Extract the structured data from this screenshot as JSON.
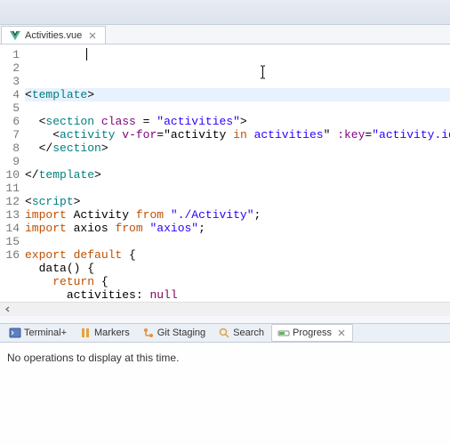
{
  "editor_tab": {
    "filename": "Activities.vue"
  },
  "code_lines": [
    {
      "n": 1,
      "html": "<span class='tk-pn'>&lt;</span><span class='tk-tag'>template</span><span class='tk-pn'>&gt;</span>",
      "current": true
    },
    {
      "n": 2,
      "html": ""
    },
    {
      "n": 3,
      "html": "  <span class='tk-pn'>&lt;</span><span class='tk-tag'>section</span> <span class='tk-attr'>class</span> <span class='tk-pn'>=</span> <span class='tk-str'>\"activities\"</span><span class='tk-pn'>&gt;</span>"
    },
    {
      "n": 4,
      "html": "    <span class='tk-pn'>&lt;</span><span class='tk-tag'>activity</span> <span class='tk-attr'>v-for</span><span class='tk-pn'>=</span><span class='tk-pn'>\"</span><span class='tk-id'>activity</span> <span class='tk-kw2'>in</span> <span class='tk-str'>activities</span><span class='tk-pn'>\"</span> <span class='tk-attr'>:key</span><span class='tk-pn'>=</span><span class='tk-str'>\"activity.id\"</span> <span class='tk-attr'>:act</span>"
    },
    {
      "n": 5,
      "html": "  <span class='tk-pn'>&lt;/</span><span class='tk-tag'>section</span><span class='tk-pn'>&gt;</span>"
    },
    {
      "n": 6,
      "html": ""
    },
    {
      "n": 7,
      "html": "<span class='tk-pn'>&lt;/</span><span class='tk-tag'>template</span><span class='tk-pn'>&gt;</span>"
    },
    {
      "n": 8,
      "html": ""
    },
    {
      "n": 9,
      "html": "<span class='tk-pn'>&lt;</span><span class='tk-tag'>script</span><span class='tk-pn'>&gt;</span>"
    },
    {
      "n": 10,
      "html": "<span class='tk-kw2'>import</span> <span class='tk-id'>Activity</span> <span class='tk-kw2'>from</span> <span class='tk-str'>\"./Activity\"</span><span class='tk-pn'>;</span>"
    },
    {
      "n": 11,
      "html": "<span class='tk-kw2'>import</span> <span class='tk-id'>axios</span> <span class='tk-kw2'>from</span> <span class='tk-str'>\"axios\"</span><span class='tk-pn'>;</span>"
    },
    {
      "n": 12,
      "html": ""
    },
    {
      "n": 13,
      "html": "<span class='tk-kw2'>export</span> <span class='tk-kw2'>default</span> <span class='tk-pn'>{</span>"
    },
    {
      "n": 14,
      "html": "  <span class='tk-id'>data</span><span class='tk-pn'>() {</span>"
    },
    {
      "n": 15,
      "html": "    <span class='tk-kw2'>return</span> <span class='tk-pn'>{</span>"
    },
    {
      "n": 16,
      "html": "      <span class='tk-id'>activities</span><span class='tk-pn'>:</span> <span class='tk-lit'>null</span>"
    }
  ],
  "bottom_tabs": [
    {
      "id": "terminal",
      "label": "Terminal+"
    },
    {
      "id": "markers",
      "label": "Markers"
    },
    {
      "id": "gitstaging",
      "label": "Git Staging"
    },
    {
      "id": "search",
      "label": "Search"
    },
    {
      "id": "progress",
      "label": "Progress",
      "active": true
    }
  ],
  "progress_panel": {
    "message": "No operations to display at this time."
  }
}
